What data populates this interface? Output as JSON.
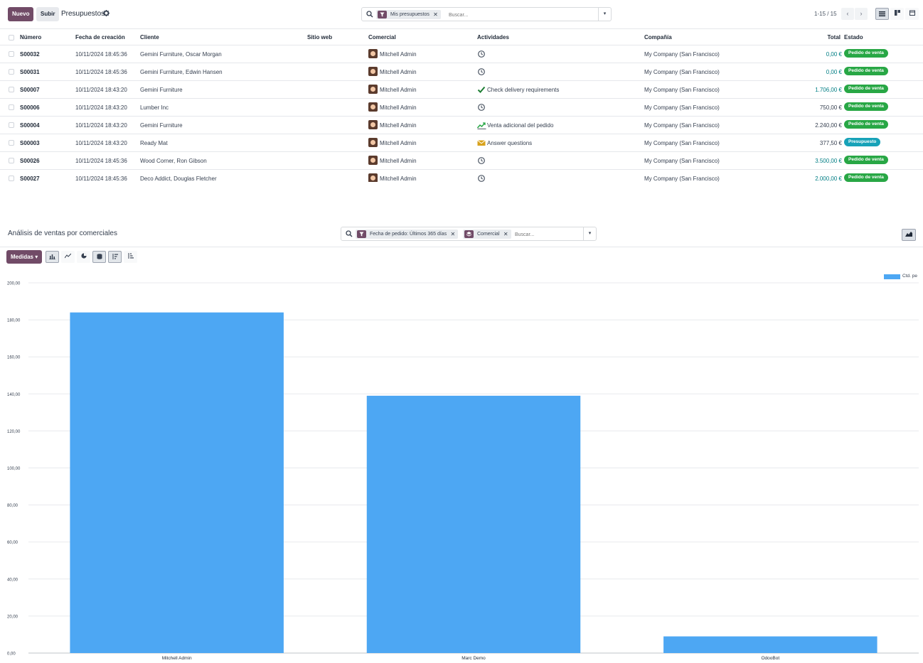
{
  "list": {
    "new_label": "Nuevo",
    "upload_label": "Subir",
    "title": "Presupuestos",
    "search": {
      "facet_label": "Mis presupuestos",
      "placeholder": "Buscar..."
    },
    "pager": "1-15 / 15",
    "columns": {
      "number": "Número",
      "created": "Fecha de creación",
      "customer": "Cliente",
      "website": "Sitio web",
      "salesperson": "Comercial",
      "activities": "Actividades",
      "company": "Compañía",
      "total": "Total",
      "state": "Estado"
    },
    "rows": [
      {
        "number": "S00032",
        "created": "10/11/2024 18:45:36",
        "customer": "Gemini Furniture, Oscar Morgan",
        "salesperson": "Mitchell Admin",
        "activity_icon": "clock-icon",
        "activity": "",
        "company": "My Company (San Francisco)",
        "total": "0,00 €",
        "total_highlight": true,
        "state": "Pedido de venta",
        "state_kind": "sale"
      },
      {
        "number": "S00031",
        "created": "10/11/2024 18:45:36",
        "customer": "Gemini Furniture, Edwin Hansen",
        "salesperson": "Mitchell Admin",
        "activity_icon": "clock-icon",
        "activity": "",
        "company": "My Company (San Francisco)",
        "total": "0,00 €",
        "total_highlight": true,
        "state": "Pedido de venta",
        "state_kind": "sale"
      },
      {
        "number": "S00007",
        "created": "10/11/2024 18:43:20",
        "customer": "Gemini Furniture",
        "salesperson": "Mitchell Admin",
        "activity_icon": "check-icon",
        "activity": "Check delivery requirements",
        "company": "My Company (San Francisco)",
        "total": "1.706,00 €",
        "total_highlight": true,
        "state": "Pedido de venta",
        "state_kind": "sale"
      },
      {
        "number": "S00006",
        "created": "10/11/2024 18:43:20",
        "customer": "Lumber Inc",
        "salesperson": "Mitchell Admin",
        "activity_icon": "clock-icon",
        "activity": "",
        "company": "My Company (San Francisco)",
        "total": "750,00 €",
        "total_highlight": false,
        "state": "Pedido de venta",
        "state_kind": "sale"
      },
      {
        "number": "S00004",
        "created": "10/11/2024 18:43:20",
        "customer": "Gemini Furniture",
        "salesperson": "Mitchell Admin",
        "activity_icon": "trend-icon",
        "activity": "Venta adicional del pedido",
        "company": "My Company (San Francisco)",
        "total": "2.240,00 €",
        "total_highlight": false,
        "state": "Pedido de venta",
        "state_kind": "sale"
      },
      {
        "number": "S00003",
        "created": "10/11/2024 18:43:20",
        "customer": "Ready Mat",
        "salesperson": "Mitchell Admin",
        "activity_icon": "envelope-icon",
        "activity": "Answer questions",
        "company": "My Company (San Francisco)",
        "total": "377,50 €",
        "total_highlight": false,
        "state": "Presupuesto",
        "state_kind": "quote"
      },
      {
        "number": "S00026",
        "created": "10/11/2024 18:45:36",
        "customer": "Wood Corner, Ron Gibson",
        "salesperson": "Mitchell Admin",
        "activity_icon": "clock-icon",
        "activity": "",
        "company": "My Company (San Francisco)",
        "total": "3.500,00 €",
        "total_highlight": true,
        "state": "Pedido de venta",
        "state_kind": "sale"
      },
      {
        "number": "S00027",
        "created": "10/11/2024 18:45:36",
        "customer": "Deco Addict, Douglas Fletcher",
        "salesperson": "Mitchell Admin",
        "activity_icon": "clock-icon",
        "activity": "",
        "company": "My Company (San Francisco)",
        "total": "2.000,00 €",
        "total_highlight": true,
        "state": "Pedido de venta",
        "state_kind": "sale"
      }
    ]
  },
  "graph": {
    "title": "Análisis de ventas por comerciales",
    "search": {
      "facet_date": "Fecha de pedido: Últimos 365 días",
      "facet_group": "Comercial",
      "placeholder": "Buscar..."
    },
    "measures_label": "Medidas"
  },
  "colors": {
    "primary": "#714b67",
    "bar": "#4da7f3",
    "sale_badge": "#28a745",
    "quote_badge": "#17a2b8",
    "teal_total": "#017e84"
  },
  "chart_data": {
    "type": "bar",
    "categories": [
      "Mitchell Admin",
      "Marc Demo",
      "OdooBot"
    ],
    "series": [
      {
        "name": "Ctd. pe",
        "values": [
          184,
          139,
          9
        ]
      }
    ],
    "xlabel": "",
    "ylabel": "",
    "ylim": [
      0,
      200
    ],
    "yticks": [
      "0,00",
      "20,00",
      "40,00",
      "60,00",
      "80,00",
      "100,00",
      "120,00",
      "140,00",
      "160,00",
      "180,00",
      "200,00"
    ],
    "grid": true,
    "legend": "top-right"
  }
}
